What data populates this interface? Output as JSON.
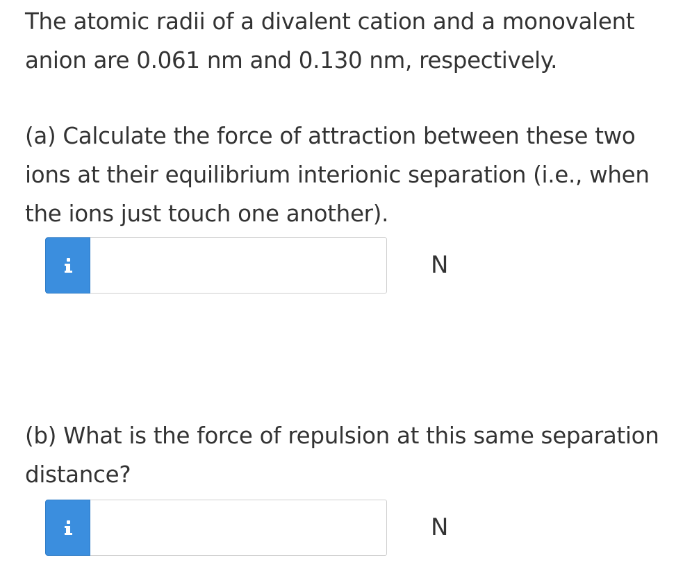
{
  "question": {
    "intro": "The atomic radii of a divalent cation and a monovalent anion are 0.061 nm and 0.130 nm, respectively.",
    "part_a": {
      "prompt": "(a) Calculate the force of attraction between these two ions at their equilibrium interionic separation (i.e., when the ions just touch one another).",
      "input_value": "",
      "info_icon": "info-icon",
      "unit": "N"
    },
    "part_b": {
      "prompt": "(b) What is the force of repulsion at this same separation distance?",
      "input_value": "",
      "info_icon": "info-icon",
      "unit": "N"
    }
  },
  "colors": {
    "info_button": "#3b8ede",
    "text": "#333333",
    "input_border": "#cfcfcf"
  }
}
